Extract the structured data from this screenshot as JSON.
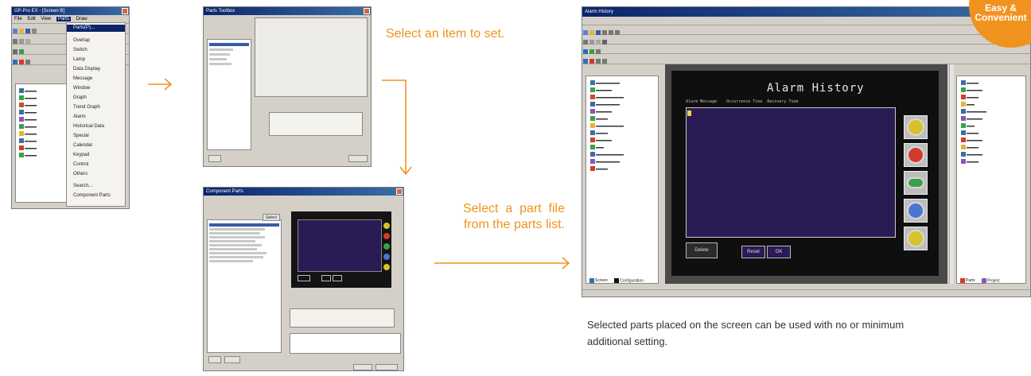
{
  "captions": {
    "step1": "Select an item to set.",
    "step2_line1": "Select  a  part  file",
    "step2_line2": "from the parts list.",
    "result_line1": "Selected parts placed on the screen can be used with no or minimum",
    "result_line2": "additional setting."
  },
  "badge": {
    "line1": "Easy &",
    "line2": "Convenient"
  },
  "colors": {
    "accent": "#f0931e",
    "screen": "#2b1b55"
  },
  "arrows": [
    "right-arrow",
    "down-arrow",
    "right-arrow"
  ],
  "editor_small": {
    "title": "GP-Pro EX - [Screen B]",
    "menu": [
      "File",
      "Edit",
      "View",
      "Parts",
      "Draw"
    ],
    "dropdown": [
      "Parts(P)...",
      "Overlap",
      "Switch",
      "Lamp",
      "Data Display",
      "Message",
      "Window",
      "Graph",
      "Trend Graph",
      "Alarm",
      "Historical Data",
      "Special",
      "Calendar",
      "Keypad",
      "Control",
      "Others",
      "Search...",
      "Component Parts"
    ]
  },
  "dialog1": {
    "title": "Parts Toolbox"
  },
  "dialog2": {
    "title": "Component Parts",
    "button": "Select"
  },
  "editor_large": {
    "title": "Alarm History",
    "screen_title": "Alarm History",
    "header_text": "Alarm Message    Occurrence Time  Recovery Time",
    "footer_buttons": [
      "Delete",
      "Reset",
      "OK"
    ],
    "bottom_tabs": [
      "Screen",
      "Configuration"
    ],
    "right_tabs": [
      "Parts",
      "Project"
    ]
  }
}
